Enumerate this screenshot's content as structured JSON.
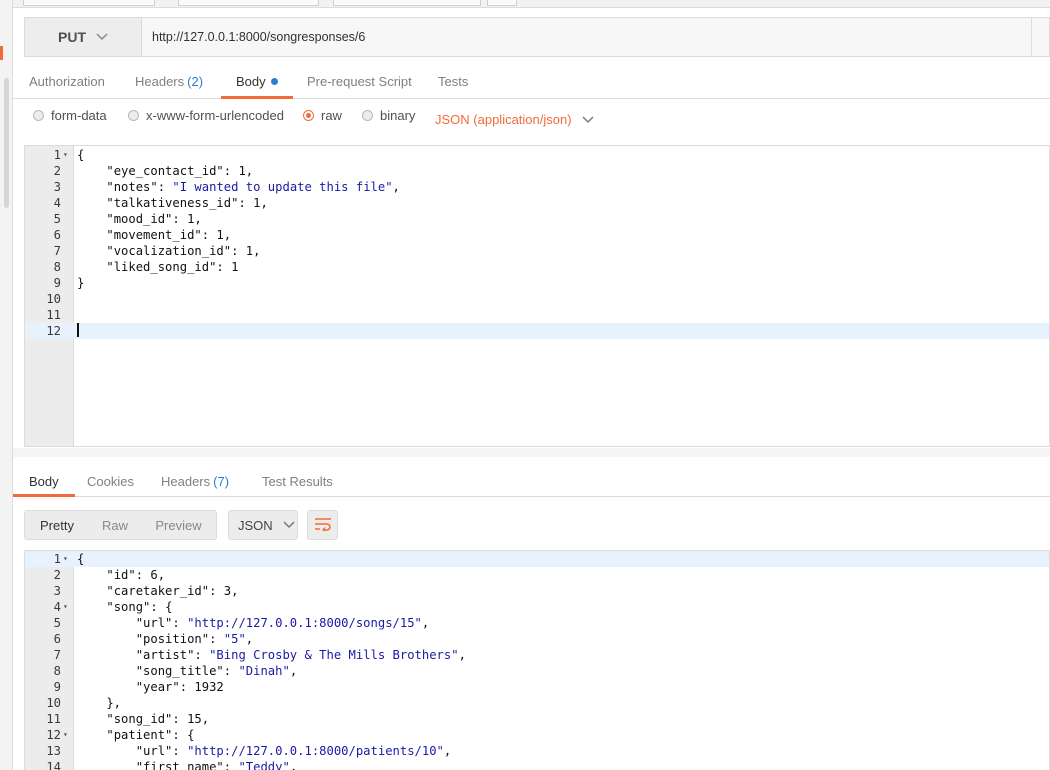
{
  "request": {
    "method": "PUT",
    "url": "http://127.0.0.1:8000/songresponses/6"
  },
  "request_tabs": [
    {
      "label": "Authorization"
    },
    {
      "label": "Headers",
      "count": "(2)"
    },
    {
      "label": "Body"
    },
    {
      "label": "Pre-request Script"
    },
    {
      "label": "Tests"
    }
  ],
  "body_types": {
    "form_data": "form-data",
    "urlencoded": "x-www-form-urlencoded",
    "raw": "raw",
    "binary": "binary",
    "content_type": "JSON (application/json)"
  },
  "request_body_lines": [
    {
      "n": "1",
      "fold": true,
      "code": "{"
    },
    {
      "n": "2",
      "code": "    \"eye_contact_id\": 1,"
    },
    {
      "n": "3",
      "code": "    \"notes\": \"I wanted to update this file\","
    },
    {
      "n": "4",
      "code": "    \"talkativeness_id\": 1,"
    },
    {
      "n": "5",
      "code": "    \"mood_id\": 1,"
    },
    {
      "n": "6",
      "code": "    \"movement_id\": 1,"
    },
    {
      "n": "7",
      "code": "    \"vocalization_id\": 1,"
    },
    {
      "n": "8",
      "code": "    \"liked_song_id\": 1"
    },
    {
      "n": "9",
      "code": "}"
    },
    {
      "n": "10",
      "code": ""
    },
    {
      "n": "11",
      "code": ""
    },
    {
      "n": "12",
      "code": "",
      "active": true
    }
  ],
  "response_tabs": [
    {
      "label": "Body"
    },
    {
      "label": "Cookies"
    },
    {
      "label": "Headers",
      "count": "(7)"
    },
    {
      "label": "Test Results"
    }
  ],
  "response_view": {
    "pretty": "Pretty",
    "raw": "Raw",
    "preview": "Preview",
    "format": "JSON"
  },
  "response_body_lines": [
    {
      "n": "1",
      "fold": true,
      "active": true,
      "code": "{"
    },
    {
      "n": "2",
      "code": "    \"id\": 6,"
    },
    {
      "n": "3",
      "code": "    \"caretaker_id\": 3,"
    },
    {
      "n": "4",
      "fold": true,
      "code": "    \"song\": {"
    },
    {
      "n": "5",
      "code": "        \"url\": \"http://127.0.0.1:8000/songs/15\","
    },
    {
      "n": "6",
      "code": "        \"position\": \"5\","
    },
    {
      "n": "7",
      "code": "        \"artist\": \"Bing Crosby & The Mills Brothers\","
    },
    {
      "n": "8",
      "code": "        \"song_title\": \"Dinah\","
    },
    {
      "n": "9",
      "code": "        \"year\": 1932"
    },
    {
      "n": "10",
      "code": "    },"
    },
    {
      "n": "11",
      "code": "    \"song_id\": 15,"
    },
    {
      "n": "12",
      "fold": true,
      "code": "    \"patient\": {"
    },
    {
      "n": "13",
      "code": "        \"url\": \"http://127.0.0.1:8000/patients/10\","
    },
    {
      "n": "14",
      "code": "        \"first_name\": \"Teddy\","
    }
  ],
  "colors": {
    "accent": "#f26b3a",
    "count_blue": "#2a7fd5",
    "string": "#1a1aa6",
    "active_line": "#e8f2fc"
  }
}
